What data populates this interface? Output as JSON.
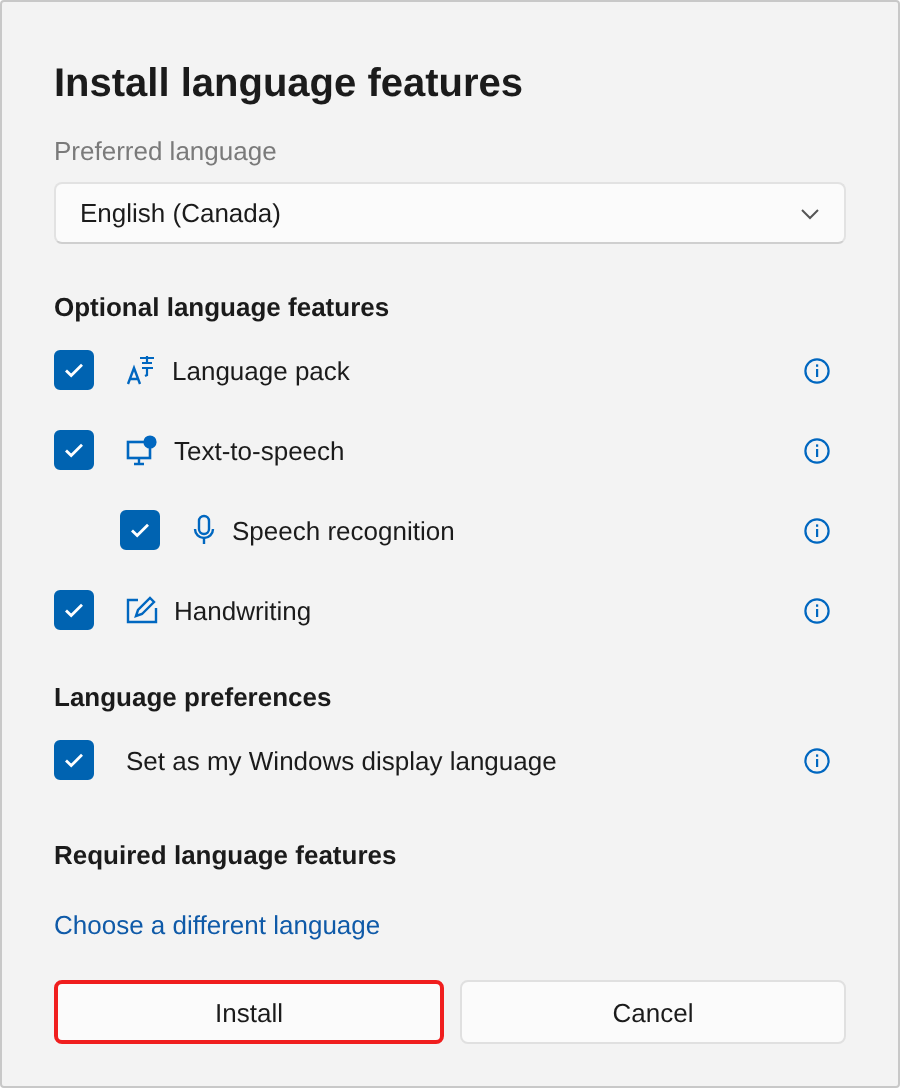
{
  "dialog": {
    "title": "Install language features"
  },
  "preferred_language": {
    "label": "Preferred language",
    "value": "English (Canada)"
  },
  "optional_features": {
    "heading": "Optional language features",
    "items": [
      {
        "label": "Language pack",
        "kind": "language-pack",
        "checked": true
      },
      {
        "label": "Text-to-speech",
        "kind": "speech",
        "checked": true,
        "children": [
          {
            "label": "Speech recognition",
            "kind": "microphone",
            "checked": true
          }
        ]
      },
      {
        "label": "Handwriting",
        "kind": "handwriting",
        "checked": true
      }
    ]
  },
  "language_preferences": {
    "heading": "Language preferences",
    "items": [
      {
        "label": "Set as my Windows display language",
        "kind": "none",
        "checked": true
      }
    ]
  },
  "required_features": {
    "heading": "Required language features"
  },
  "link": "Choose a different language",
  "buttons": [
    {
      "label": "Install",
      "highlighted": true
    },
    {
      "label": "Cancel",
      "highlighted": false
    }
  ]
}
